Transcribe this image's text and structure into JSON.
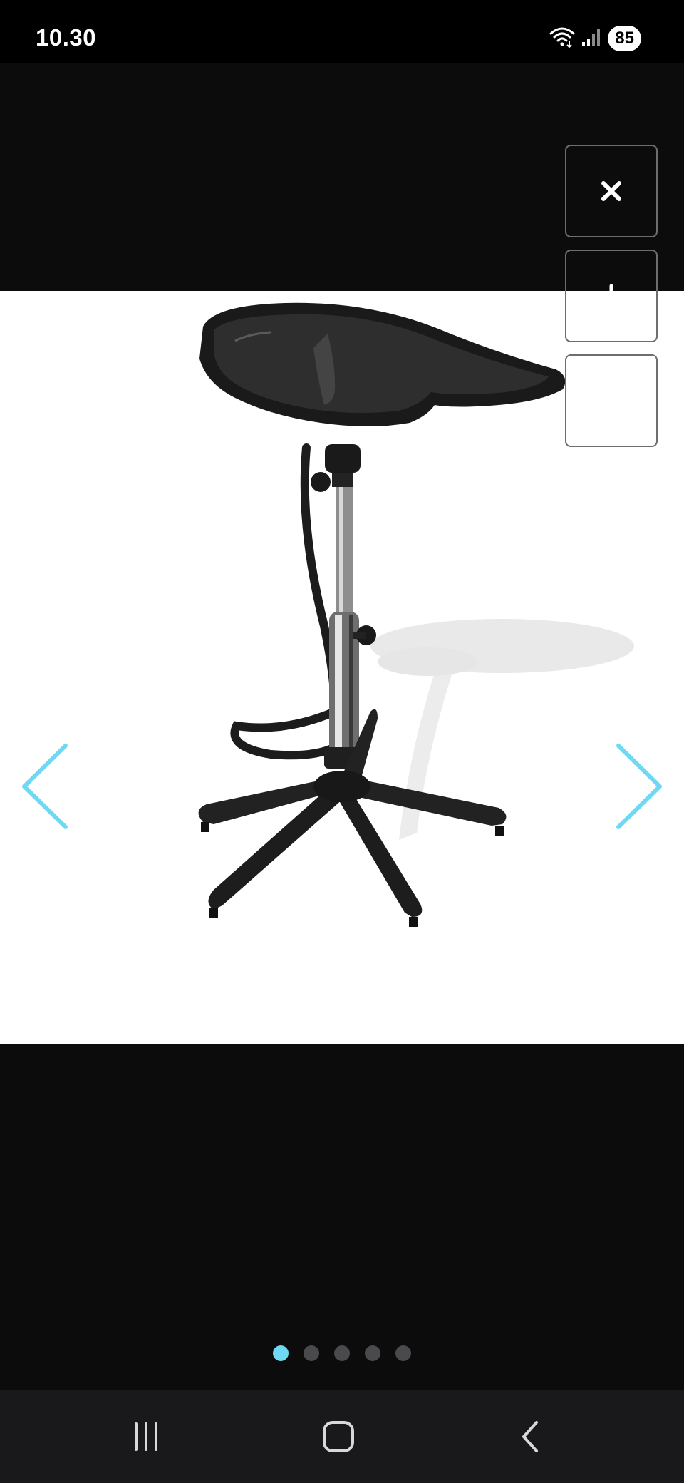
{
  "status_bar": {
    "time": "10.30",
    "battery_level": "85",
    "icons": [
      "wifi-icon",
      "signal-icon",
      "battery-icon"
    ]
  },
  "viewer": {
    "actions": [
      {
        "name": "close",
        "icon": "close-icon"
      },
      {
        "name": "zoom-in",
        "icon": "plus-icon"
      },
      {
        "name": "zoom-out",
        "icon": "minus-icon"
      }
    ],
    "navigation": {
      "prev_icon": "chevron-left-icon",
      "next_icon": "chevron-right-icon",
      "accent_color": "#6fd8f3"
    },
    "image": {
      "subject": "salon-shampoo-basin-stand",
      "background": "#ffffff"
    },
    "pagination": {
      "total": 5,
      "current": 1,
      "active_color": "#6fd8f3",
      "inactive_color": "#4a4a4d"
    }
  },
  "system_nav": {
    "buttons": [
      {
        "name": "recents",
        "icon": "recents-icon"
      },
      {
        "name": "home",
        "icon": "home-icon"
      },
      {
        "name": "back",
        "icon": "back-icon"
      }
    ]
  }
}
